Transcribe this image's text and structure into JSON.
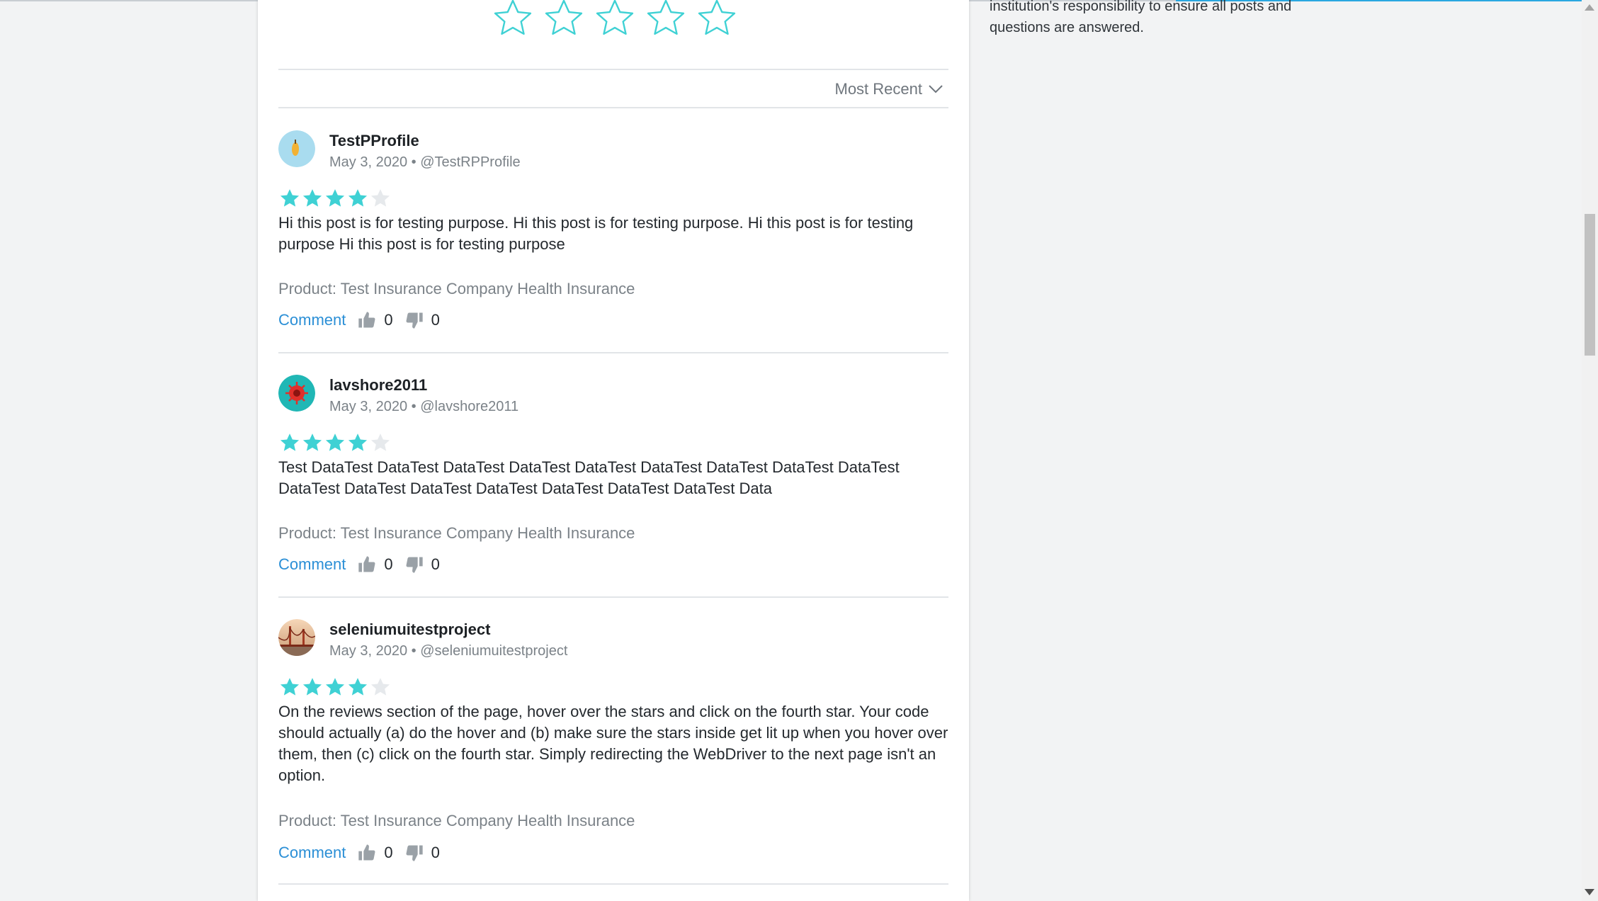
{
  "rating_prompt": {
    "star_count": 5
  },
  "sort": {
    "label": "Most Recent"
  },
  "side_note": {
    "line1": "institution's responsibility to ensure all posts and",
    "line2": "questions are answered."
  },
  "reviews": [
    {
      "username": "TestPProfile",
      "date": "May 3, 2020",
      "handle": "@TestRPProfile",
      "rating": 4,
      "text": "Hi this post is for testing purpose. Hi this post is for testing purpose. Hi this post is for testing purpose Hi this post is for testing purpose",
      "product": "Product: Test Insurance Company Health Insurance",
      "comment_label": "Comment",
      "upvotes": "0",
      "downvotes": "0"
    },
    {
      "username": "lavshore2011",
      "date": "May 3, 2020",
      "handle": "@lavshore2011",
      "rating": 4,
      "text": "Test DataTest DataTest DataTest DataTest DataTest DataTest DataTest DataTest DataTest DataTest DataTest DataTest DataTest DataTest DataTest DataTest Data",
      "product": "Product: Test Insurance Company Health Insurance",
      "comment_label": "Comment",
      "upvotes": "0",
      "downvotes": "0"
    },
    {
      "username": "seleniumuitestproject",
      "date": "May 3, 2020",
      "handle": "@seleniumuitestproject",
      "rating": 4,
      "text": "On the reviews section of the page, hover over the stars and click on the fourth star. Your code should actually (a) do the hover and (b) make sure the stars inside get lit up when you hover over them, then (c) click on the fourth star. Simply redirecting the WebDriver to the next page isn't an option.",
      "product": "Product: Test Insurance Company Health Insurance",
      "comment_label": "Comment",
      "upvotes": "0",
      "downvotes": "0"
    }
  ],
  "colors": {
    "accent": "#3fd1d4",
    "link": "#2b8fd6",
    "muted": "#7b8288"
  },
  "icons": [
    "star-outline-icon",
    "star-filled-icon",
    "chevron-down-icon",
    "thumbs-up-icon",
    "thumbs-down-icon"
  ]
}
